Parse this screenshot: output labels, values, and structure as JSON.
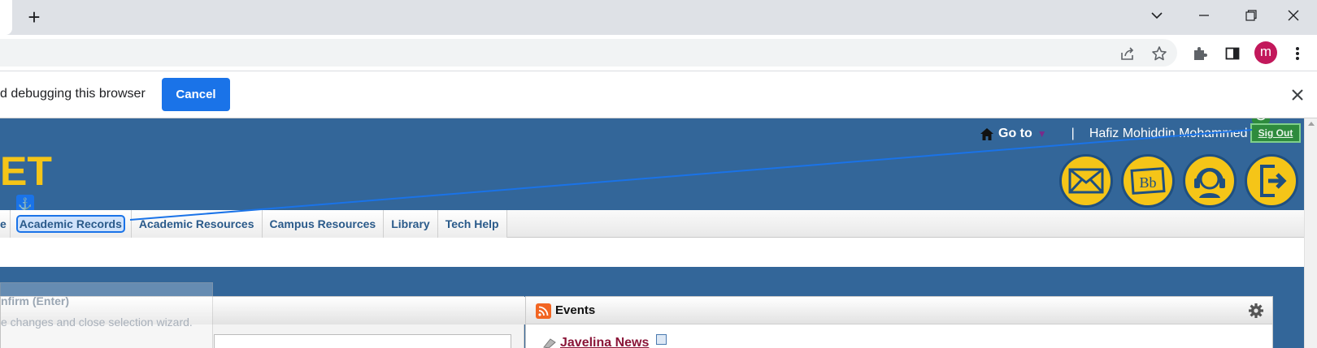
{
  "browser": {
    "new_tab_label": "+",
    "profile_initial": "m"
  },
  "infobar": {
    "message": "d debugging this browser",
    "cancel_label": "Cancel"
  },
  "site": {
    "logo_text": "ET",
    "goto_label": "Go to",
    "separator": "|",
    "user_name": "Hafiz Mohiddin Mohammed",
    "signout_label": "Sig Out",
    "nav": [
      {
        "label": "e"
      },
      {
        "label": "Academic Records"
      },
      {
        "label": "Academic Resources"
      },
      {
        "label": "Campus Resources"
      },
      {
        "label": "Library"
      },
      {
        "label": "Tech Help"
      }
    ],
    "quick_icons": [
      "mail-icon",
      "blackboard-icon",
      "helpdesk-icon",
      "exit-icon"
    ],
    "brand_color": "#336699",
    "accent_color": "#f5c518"
  },
  "wizard": {
    "title": "nfirm (Enter)",
    "description": "e changes and close selection wizard."
  },
  "events": {
    "title": "Events",
    "news_link": "Javelina News"
  }
}
